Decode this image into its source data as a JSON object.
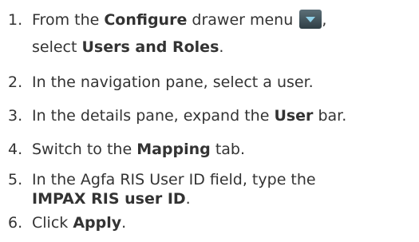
{
  "steps": [
    {
      "number": "1.",
      "line1_a": "From the ",
      "line1_b": "Configure",
      "line1_c": " drawer menu ",
      "line1_d": ",",
      "line2_a": "select ",
      "line2_b": "Users and Roles",
      "line2_c": ".",
      "icon": "dropdown-arrow-icon"
    },
    {
      "number": "2.",
      "text": "In the navigation pane, select a user."
    },
    {
      "number": "3.",
      "a": "In the details pane, expand the ",
      "b": "User",
      "c": " bar."
    },
    {
      "number": "4.",
      "a": "Switch to the ",
      "b": "Mapping",
      "c": " tab."
    },
    {
      "number": "5.",
      "line1": "In the Agfa RIS User ID field, type the",
      "line2_b": "IMPAX RIS user ID",
      "line2_c": "."
    },
    {
      "number": "6.",
      "a": "Click ",
      "b": "Apply",
      "c": "."
    }
  ]
}
